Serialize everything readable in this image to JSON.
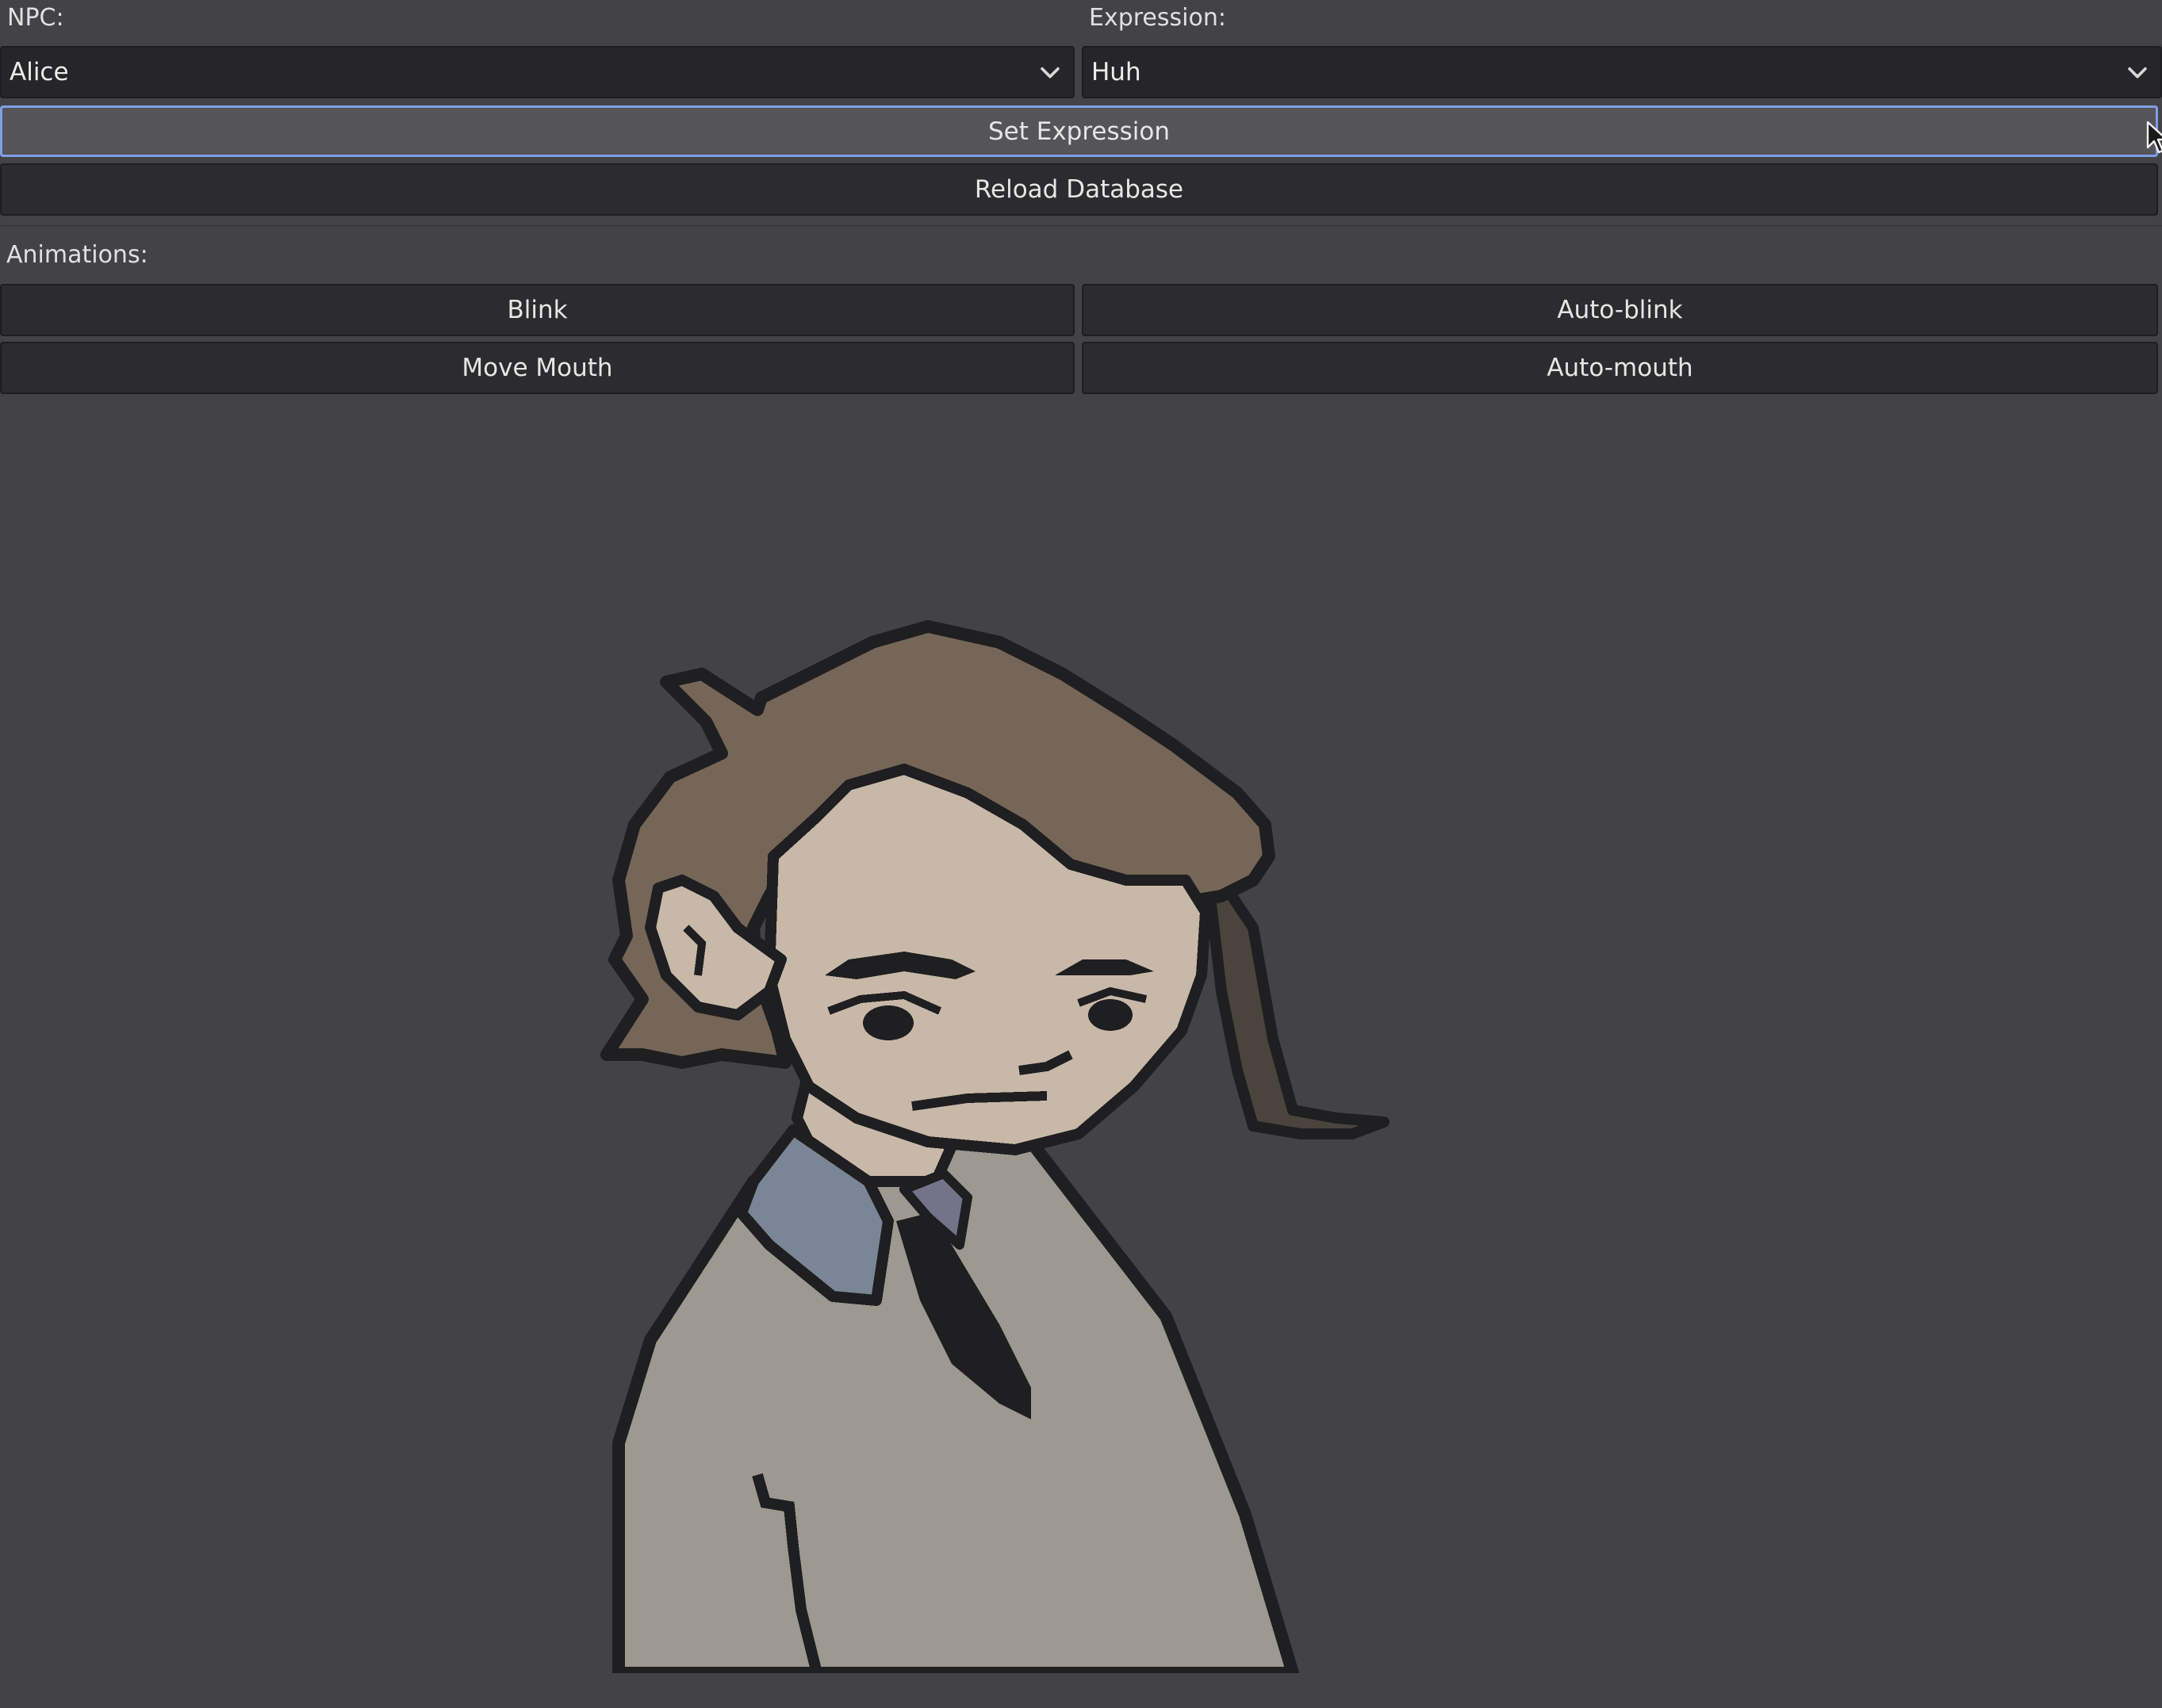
{
  "npc": {
    "label": "NPC:",
    "selected": "Alice"
  },
  "expression": {
    "label": "Expression:",
    "selected": "Huh"
  },
  "actions": {
    "set_expression": "Set Expression",
    "reload_database": "Reload Database"
  },
  "animations": {
    "label": "Animations:",
    "blink": "Blink",
    "auto_blink": "Auto-blink",
    "move_mouth": "Move Mouth",
    "auto_mouth": "Auto-mouth"
  },
  "icons": {
    "dropdown": "chevron-down-icon",
    "pointer": "mouse-cursor-icon"
  },
  "colors": {
    "background": "#434246",
    "field_bg": "#262629",
    "button_bg": "#2c2c2f",
    "focus_border": "#7e9fe8",
    "hair": "#766657",
    "skin": "#c8b8a8",
    "collar": "#7a8595",
    "coat": "#9d9890",
    "outline": "#1f1f21"
  }
}
